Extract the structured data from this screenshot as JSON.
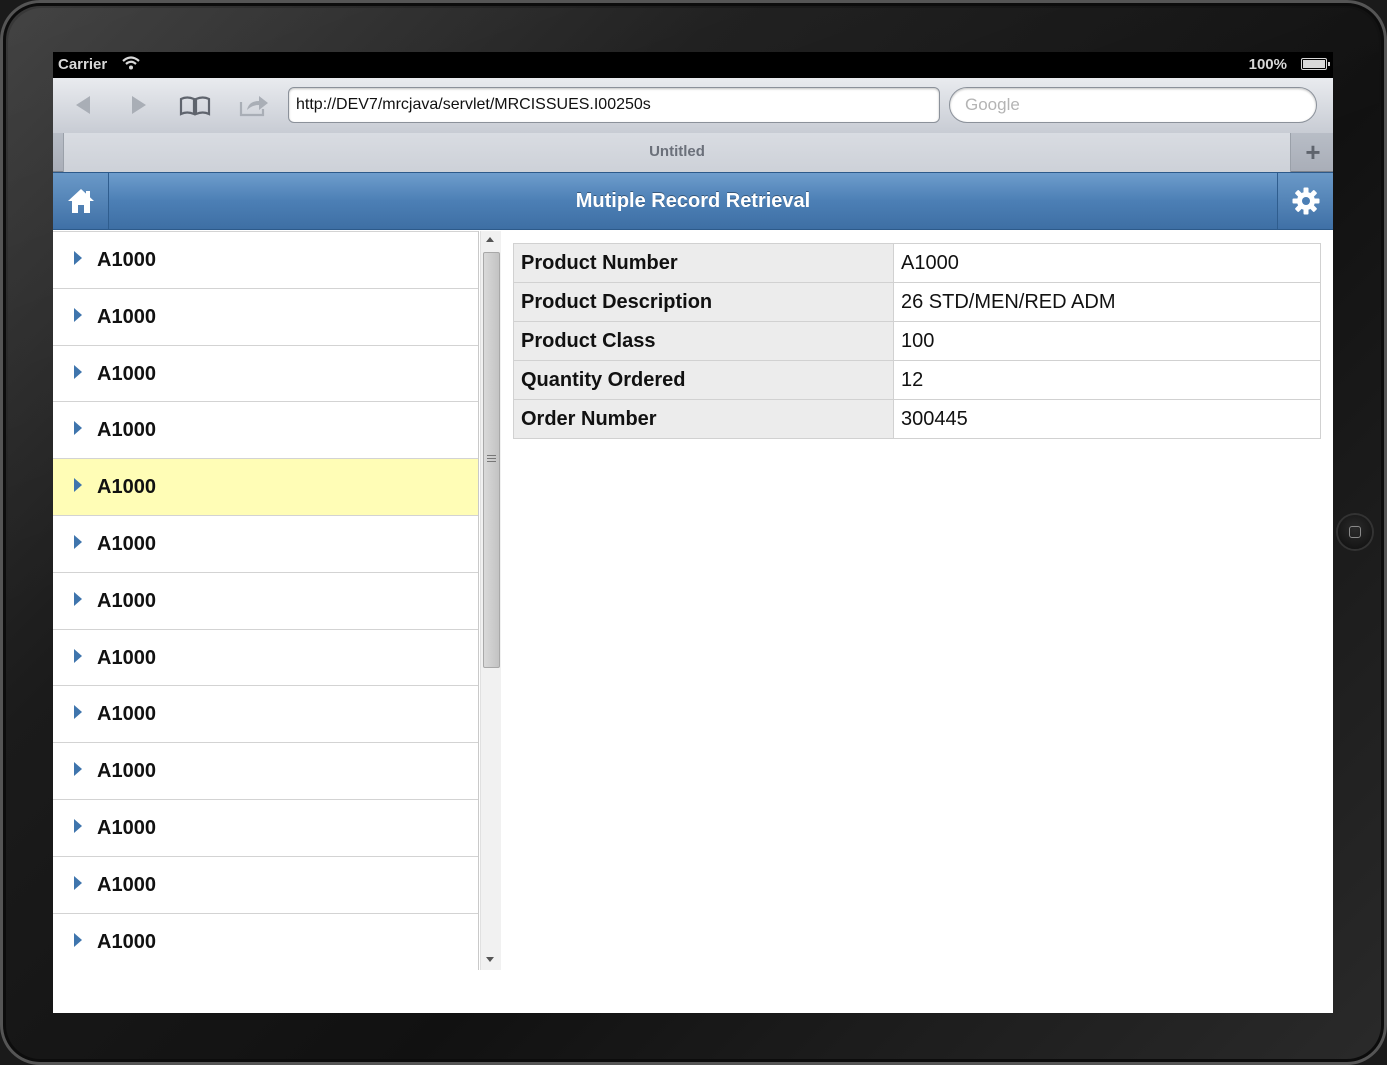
{
  "status_bar": {
    "carrier": "Carrier",
    "battery": "100%"
  },
  "browser": {
    "url": "http://DEV7/mrcjava/servlet/MRCISSUES.I00250s",
    "search_placeholder": "Google",
    "tab_title": "Untitled",
    "new_tab_label": "+"
  },
  "header": {
    "title": "Mutiple Record Retrieval"
  },
  "list": {
    "items": [
      {
        "label": "A1000"
      },
      {
        "label": "A1000"
      },
      {
        "label": "A1000"
      },
      {
        "label": "A1000"
      },
      {
        "label": "A1000"
      },
      {
        "label": "A1000"
      },
      {
        "label": "A1000"
      },
      {
        "label": "A1000"
      },
      {
        "label": "A1000"
      },
      {
        "label": "A1000"
      },
      {
        "label": "A1000"
      },
      {
        "label": "A1000"
      },
      {
        "label": "A1000"
      }
    ],
    "selected_index": 4
  },
  "detail": {
    "rows": [
      {
        "label": "Product Number",
        "value": "A1000"
      },
      {
        "label": "Product Description",
        "value": "26 STD/MEN/RED ADM"
      },
      {
        "label": "Product Class",
        "value": "100"
      },
      {
        "label": "Quantity Ordered",
        "value": "12"
      },
      {
        "label": "Order Number",
        "value": "300445"
      }
    ]
  },
  "colors": {
    "header_blue": "#4c7fb5",
    "selected_row": "#fffdb6",
    "arrow_blue": "#3f75ad"
  },
  "icons": [
    "wifi-icon",
    "battery-icon",
    "back-arrow-icon",
    "forward-arrow-icon",
    "bookmarks-icon",
    "share-icon",
    "home-icon",
    "gear-icon",
    "disclosure-arrow-icon"
  ]
}
